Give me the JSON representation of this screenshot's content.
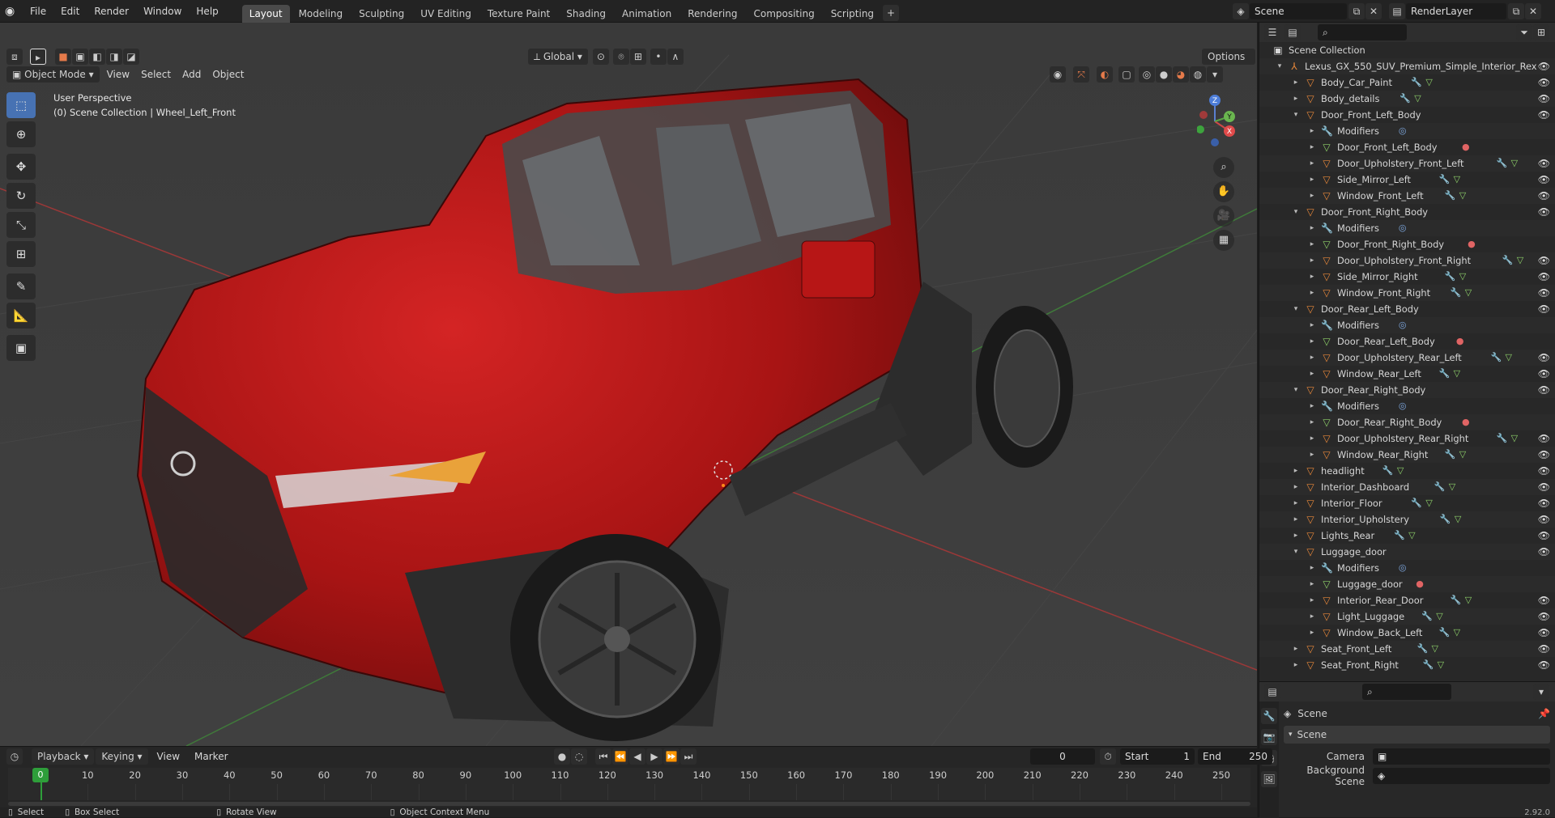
{
  "topbar": {
    "menus": [
      "File",
      "Edit",
      "Render",
      "Window",
      "Help"
    ],
    "workspaces": [
      "Layout",
      "Modeling",
      "Sculpting",
      "UV Editing",
      "Texture Paint",
      "Shading",
      "Animation",
      "Rendering",
      "Compositing",
      "Scripting"
    ],
    "active_workspace": "Layout",
    "scene_label": "Scene",
    "render_layer_label": "RenderLayer"
  },
  "viewport_header": {
    "mode": "Object Mode",
    "menus": [
      "View",
      "Select",
      "Add",
      "Object"
    ],
    "orientation": "Global",
    "options_label": "Options"
  },
  "viewport": {
    "view_name": "User Perspective",
    "context": "(0) Scene Collection | Wheel_Left_Front",
    "colors": {
      "bg": "#3d3d3d",
      "car_red": "#b01818",
      "grid_red": "#b23a3a",
      "grid_green": "#3c7a3a"
    }
  },
  "toolbar": {
    "tools": [
      "select-box",
      "cursor",
      "move",
      "rotate",
      "scale",
      "transform",
      "annotate",
      "measure",
      "add-cube"
    ]
  },
  "outliner": {
    "search_placeholder": "",
    "rows": [
      {
        "label": "Scene Collection",
        "depth": 0,
        "icon": "collection",
        "caret": "",
        "eye": false
      },
      {
        "label": "Lexus_GX_550_SUV_Premium_Simple_Interior_Rex",
        "depth": 1,
        "icon": "empty",
        "caret": "▾",
        "eye": true
      },
      {
        "label": "Body_Car_Paint",
        "depth": 2,
        "icon": "mesh",
        "caret": "▸",
        "eye": true,
        "extras": [
          "mod",
          "data"
        ]
      },
      {
        "label": "Body_details",
        "depth": 2,
        "icon": "mesh",
        "caret": "▸",
        "eye": true,
        "extras": [
          "mod",
          "data"
        ]
      },
      {
        "label": "Door_Front_Left_Body",
        "depth": 2,
        "icon": "mesh",
        "caret": "▾",
        "eye": true
      },
      {
        "label": "Modifiers",
        "depth": 3,
        "icon": "wrench",
        "caret": "▸",
        "eye": false,
        "extras": [
          "modblue"
        ]
      },
      {
        "label": "Door_Front_Left_Body",
        "depth": 3,
        "icon": "data",
        "caret": "▸",
        "eye": false,
        "extras": [
          "mat"
        ]
      },
      {
        "label": "Door_Upholstery_Front_Left",
        "depth": 3,
        "icon": "mesh",
        "caret": "▸",
        "eye": true,
        "extras": [
          "mod",
          "data"
        ]
      },
      {
        "label": "Side_Mirror_Left",
        "depth": 3,
        "icon": "mesh",
        "caret": "▸",
        "eye": true,
        "extras": [
          "mod",
          "data"
        ]
      },
      {
        "label": "Window_Front_Left",
        "depth": 3,
        "icon": "mesh",
        "caret": "▸",
        "eye": true,
        "extras": [
          "mod",
          "data"
        ]
      },
      {
        "label": "Door_Front_Right_Body",
        "depth": 2,
        "icon": "mesh",
        "caret": "▾",
        "eye": true
      },
      {
        "label": "Modifiers",
        "depth": 3,
        "icon": "wrench",
        "caret": "▸",
        "eye": false,
        "extras": [
          "modblue"
        ]
      },
      {
        "label": "Door_Front_Right_Body",
        "depth": 3,
        "icon": "data",
        "caret": "▸",
        "eye": false,
        "extras": [
          "mat"
        ]
      },
      {
        "label": "Door_Upholstery_Front_Right",
        "depth": 3,
        "icon": "mesh",
        "caret": "▸",
        "eye": true,
        "extras": [
          "mod",
          "data"
        ]
      },
      {
        "label": "Side_Mirror_Right",
        "depth": 3,
        "icon": "mesh",
        "caret": "▸",
        "eye": true,
        "extras": [
          "mod",
          "data"
        ]
      },
      {
        "label": "Window_Front_Right",
        "depth": 3,
        "icon": "mesh",
        "caret": "▸",
        "eye": true,
        "extras": [
          "mod",
          "data"
        ]
      },
      {
        "label": "Door_Rear_Left_Body",
        "depth": 2,
        "icon": "mesh",
        "caret": "▾",
        "eye": true
      },
      {
        "label": "Modifiers",
        "depth": 3,
        "icon": "wrench",
        "caret": "▸",
        "eye": false,
        "extras": [
          "modblue"
        ]
      },
      {
        "label": "Door_Rear_Left_Body",
        "depth": 3,
        "icon": "data",
        "caret": "▸",
        "eye": false,
        "extras": [
          "mat"
        ]
      },
      {
        "label": "Door_Upholstery_Rear_Left",
        "depth": 3,
        "icon": "mesh",
        "caret": "▸",
        "eye": true,
        "extras": [
          "mod",
          "data"
        ]
      },
      {
        "label": "Window_Rear_Left",
        "depth": 3,
        "icon": "mesh",
        "caret": "▸",
        "eye": true,
        "extras": [
          "mod",
          "data"
        ]
      },
      {
        "label": "Door_Rear_Right_Body",
        "depth": 2,
        "icon": "mesh",
        "caret": "▾",
        "eye": true
      },
      {
        "label": "Modifiers",
        "depth": 3,
        "icon": "wrench",
        "caret": "▸",
        "eye": false,
        "extras": [
          "modblue"
        ]
      },
      {
        "label": "Door_Rear_Right_Body",
        "depth": 3,
        "icon": "data",
        "caret": "▸",
        "eye": false,
        "extras": [
          "mat"
        ]
      },
      {
        "label": "Door_Upholstery_Rear_Right",
        "depth": 3,
        "icon": "mesh",
        "caret": "▸",
        "eye": true,
        "extras": [
          "mod",
          "data"
        ]
      },
      {
        "label": "Window_Rear_Right",
        "depth": 3,
        "icon": "mesh",
        "caret": "▸",
        "eye": true,
        "extras": [
          "mod",
          "data"
        ]
      },
      {
        "label": "headlight",
        "depth": 2,
        "icon": "mesh",
        "caret": "▸",
        "eye": true,
        "extras": [
          "mod",
          "data"
        ]
      },
      {
        "label": "Interior_Dashboard",
        "depth": 2,
        "icon": "mesh",
        "caret": "▸",
        "eye": true,
        "extras": [
          "mod",
          "data"
        ]
      },
      {
        "label": "Interior_Floor",
        "depth": 2,
        "icon": "mesh",
        "caret": "▸",
        "eye": true,
        "extras": [
          "mod",
          "data"
        ]
      },
      {
        "label": "Interior_Upholstery",
        "depth": 2,
        "icon": "mesh",
        "caret": "▸",
        "eye": true,
        "extras": [
          "mod",
          "data"
        ]
      },
      {
        "label": "Lights_Rear",
        "depth": 2,
        "icon": "mesh",
        "caret": "▸",
        "eye": true,
        "extras": [
          "mod",
          "data"
        ]
      },
      {
        "label": "Luggage_door",
        "depth": 2,
        "icon": "mesh",
        "caret": "▾",
        "eye": true
      },
      {
        "label": "Modifiers",
        "depth": 3,
        "icon": "wrench",
        "caret": "▸",
        "eye": false,
        "extras": [
          "modblue"
        ]
      },
      {
        "label": "Luggage_door",
        "depth": 3,
        "icon": "data",
        "caret": "▸",
        "eye": false,
        "extras": [
          "mat"
        ]
      },
      {
        "label": "Interior_Rear_Door",
        "depth": 3,
        "icon": "mesh",
        "caret": "▸",
        "eye": true,
        "extras": [
          "mod",
          "data"
        ]
      },
      {
        "label": "Light_Luggage",
        "depth": 3,
        "icon": "mesh",
        "caret": "▸",
        "eye": true,
        "extras": [
          "mod",
          "data"
        ]
      },
      {
        "label": "Window_Back_Left",
        "depth": 3,
        "icon": "mesh",
        "caret": "▸",
        "eye": true,
        "extras": [
          "mod",
          "data"
        ]
      },
      {
        "label": "Seat_Front_Left",
        "depth": 2,
        "icon": "mesh",
        "caret": "▸",
        "eye": true,
        "extras": [
          "mod",
          "data"
        ]
      },
      {
        "label": "Seat_Front_Right",
        "depth": 2,
        "icon": "mesh",
        "caret": "▸",
        "eye": true,
        "extras": [
          "mod",
          "data"
        ]
      }
    ]
  },
  "properties": {
    "breadcrumb": "Scene",
    "panel_title": "Scene",
    "camera_label": "Camera",
    "background_scene_label": "Background Scene"
  },
  "timeline": {
    "menus": [
      "Playback",
      "Keying",
      "View",
      "Marker"
    ],
    "current_frame": "0",
    "start_label": "Start",
    "start_value": "1",
    "end_label": "End",
    "end_value": "250",
    "ticks": [
      "0",
      "10",
      "20",
      "30",
      "40",
      "50",
      "60",
      "70",
      "80",
      "90",
      "100",
      "110",
      "120",
      "130",
      "140",
      "150",
      "160",
      "170",
      "180",
      "190",
      "200",
      "210",
      "220",
      "230",
      "240",
      "250"
    ],
    "playhead_frame": "0"
  },
  "statusbar": {
    "items": [
      "Select",
      "Box Select",
      "Rotate View",
      "Object Context Menu"
    ],
    "version": "2.92.0"
  }
}
